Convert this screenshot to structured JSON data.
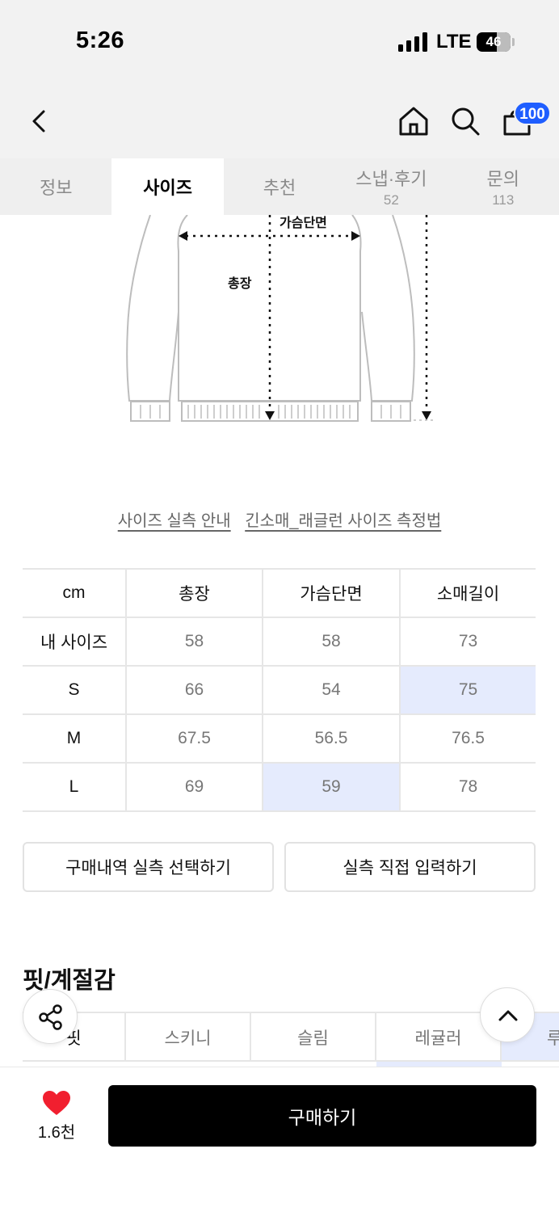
{
  "status_bar": {
    "time": "5:26",
    "network": "LTE",
    "battery": "46"
  },
  "header": {
    "cart_count": "100"
  },
  "tabs": [
    {
      "label": "정보",
      "count": ""
    },
    {
      "label": "사이즈",
      "count": ""
    },
    {
      "label": "추천",
      "count": ""
    },
    {
      "label": "스냅·후기",
      "count": "52"
    },
    {
      "label": "문의",
      "count": "113"
    }
  ],
  "active_tab": "사이즈",
  "diagram": {
    "chest_label": "가슴단면",
    "length_label": "총장"
  },
  "links": {
    "guide": "사이즈 실측 안내",
    "method": "긴소매_래글런 사이즈 측정법"
  },
  "size_table": {
    "headers": [
      "cm",
      "총장",
      "가슴단면",
      "소매길이"
    ],
    "rows": [
      [
        "내 사이즈",
        "58",
        "58",
        "73"
      ],
      [
        "S",
        "66",
        "54",
        "75"
      ],
      [
        "M",
        "67.5",
        "56.5",
        "76.5"
      ],
      [
        "L",
        "69",
        "59",
        "78"
      ]
    ]
  },
  "buttons": {
    "history": "구매내역 실측 선택하기",
    "direct": "실측 직접 입력하기"
  },
  "fit": {
    "title": "핏/계절감",
    "row_label": "핏",
    "options": [
      "스키니",
      "슬림",
      "레귤러",
      "루"
    ]
  },
  "bottom": {
    "like_count": "1.6천",
    "buy_label": "구매하기"
  },
  "colors": {
    "highlight": "#e5ebfd",
    "badge": "#1f5eff",
    "heart": "#f11f2f"
  }
}
